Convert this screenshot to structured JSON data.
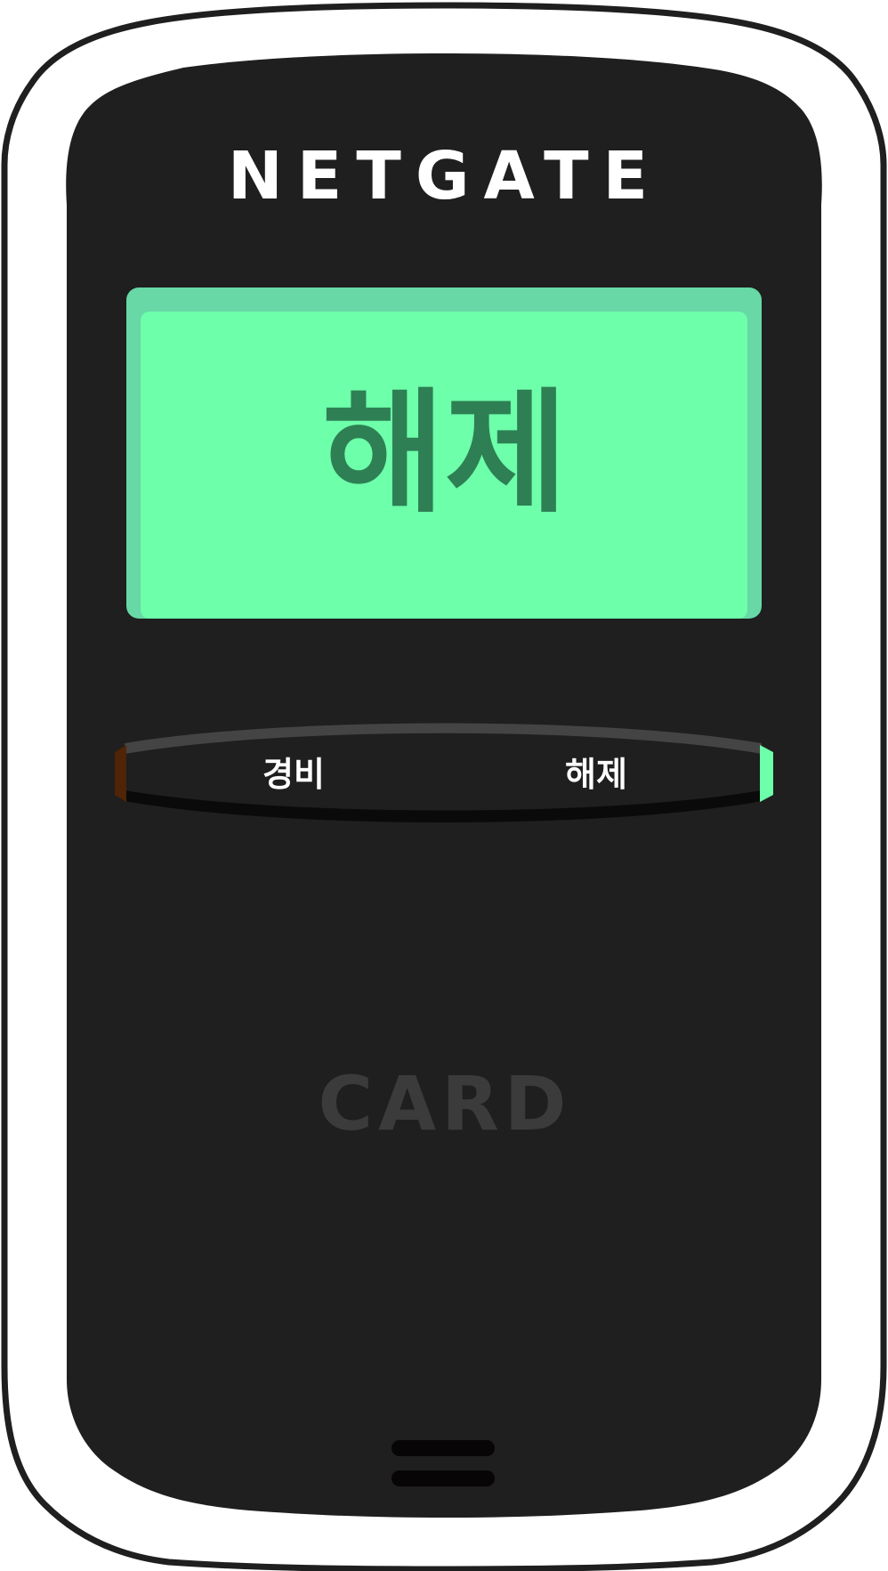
{
  "device": {
    "brand": "NETGATE",
    "screen": {
      "status_text": "해제"
    },
    "buttons": {
      "arm_label": "경비",
      "disarm_label": "해제"
    },
    "card_label": "CARD"
  },
  "colors": {
    "body": "#1e1f1e",
    "screen": "#6dffaa",
    "screen_text": "#2e7f54",
    "arm_indicator": "#4f2407",
    "disarm_indicator": "#6dffaa"
  }
}
